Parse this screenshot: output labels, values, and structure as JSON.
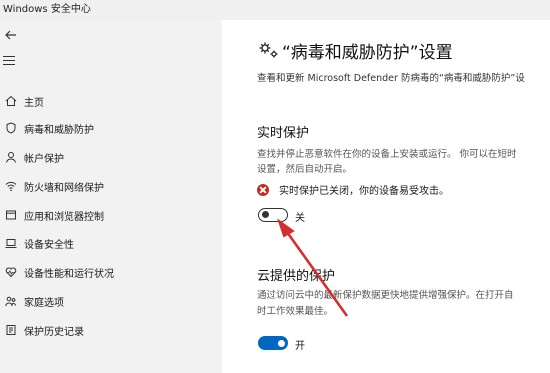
{
  "window": {
    "title": "Windows 安全中心"
  },
  "sidebar": {
    "items": [
      {
        "label": "主页",
        "icon": "home-icon"
      },
      {
        "label": "病毒和威胁防护",
        "icon": "shield-icon"
      },
      {
        "label": "帐户保护",
        "icon": "person-icon"
      },
      {
        "label": "防火墙和网络保护",
        "icon": "wifi-icon"
      },
      {
        "label": "应用和浏览器控制",
        "icon": "app-window-icon"
      },
      {
        "label": "设备安全性",
        "icon": "laptop-icon"
      },
      {
        "label": "设备性能和运行状况",
        "icon": "heart-icon"
      },
      {
        "label": "家庭选项",
        "icon": "family-icon"
      },
      {
        "label": "保护历史记录",
        "icon": "history-icon"
      }
    ]
  },
  "main": {
    "title": "“病毒和威胁防护”设置",
    "subtitle": "查看和更新 Microsoft Defender 防病毒的“病毒和威胁防护”设",
    "realtime": {
      "heading": "实时保护",
      "desc_line1": "查找并停止恶意软件在你的设备上安装或运行。 你可以在短时",
      "desc_line2": "设置，然后自动开启。",
      "warning": "实时保护已关闭，你的设备易受攻击。",
      "toggle_label": "关",
      "toggle_on": false
    },
    "cloud": {
      "heading": "云提供的保护",
      "desc_line1": "通过访问云中的最新保护数据更快地提供增强保护。在打开自",
      "desc_line2": "时工作效果最佳。",
      "toggle_label": "开",
      "toggle_on": true
    }
  },
  "colors": {
    "accent": "#0067c0",
    "warning": "#c42b1c",
    "annotation_arrow": "#d32f2f"
  }
}
